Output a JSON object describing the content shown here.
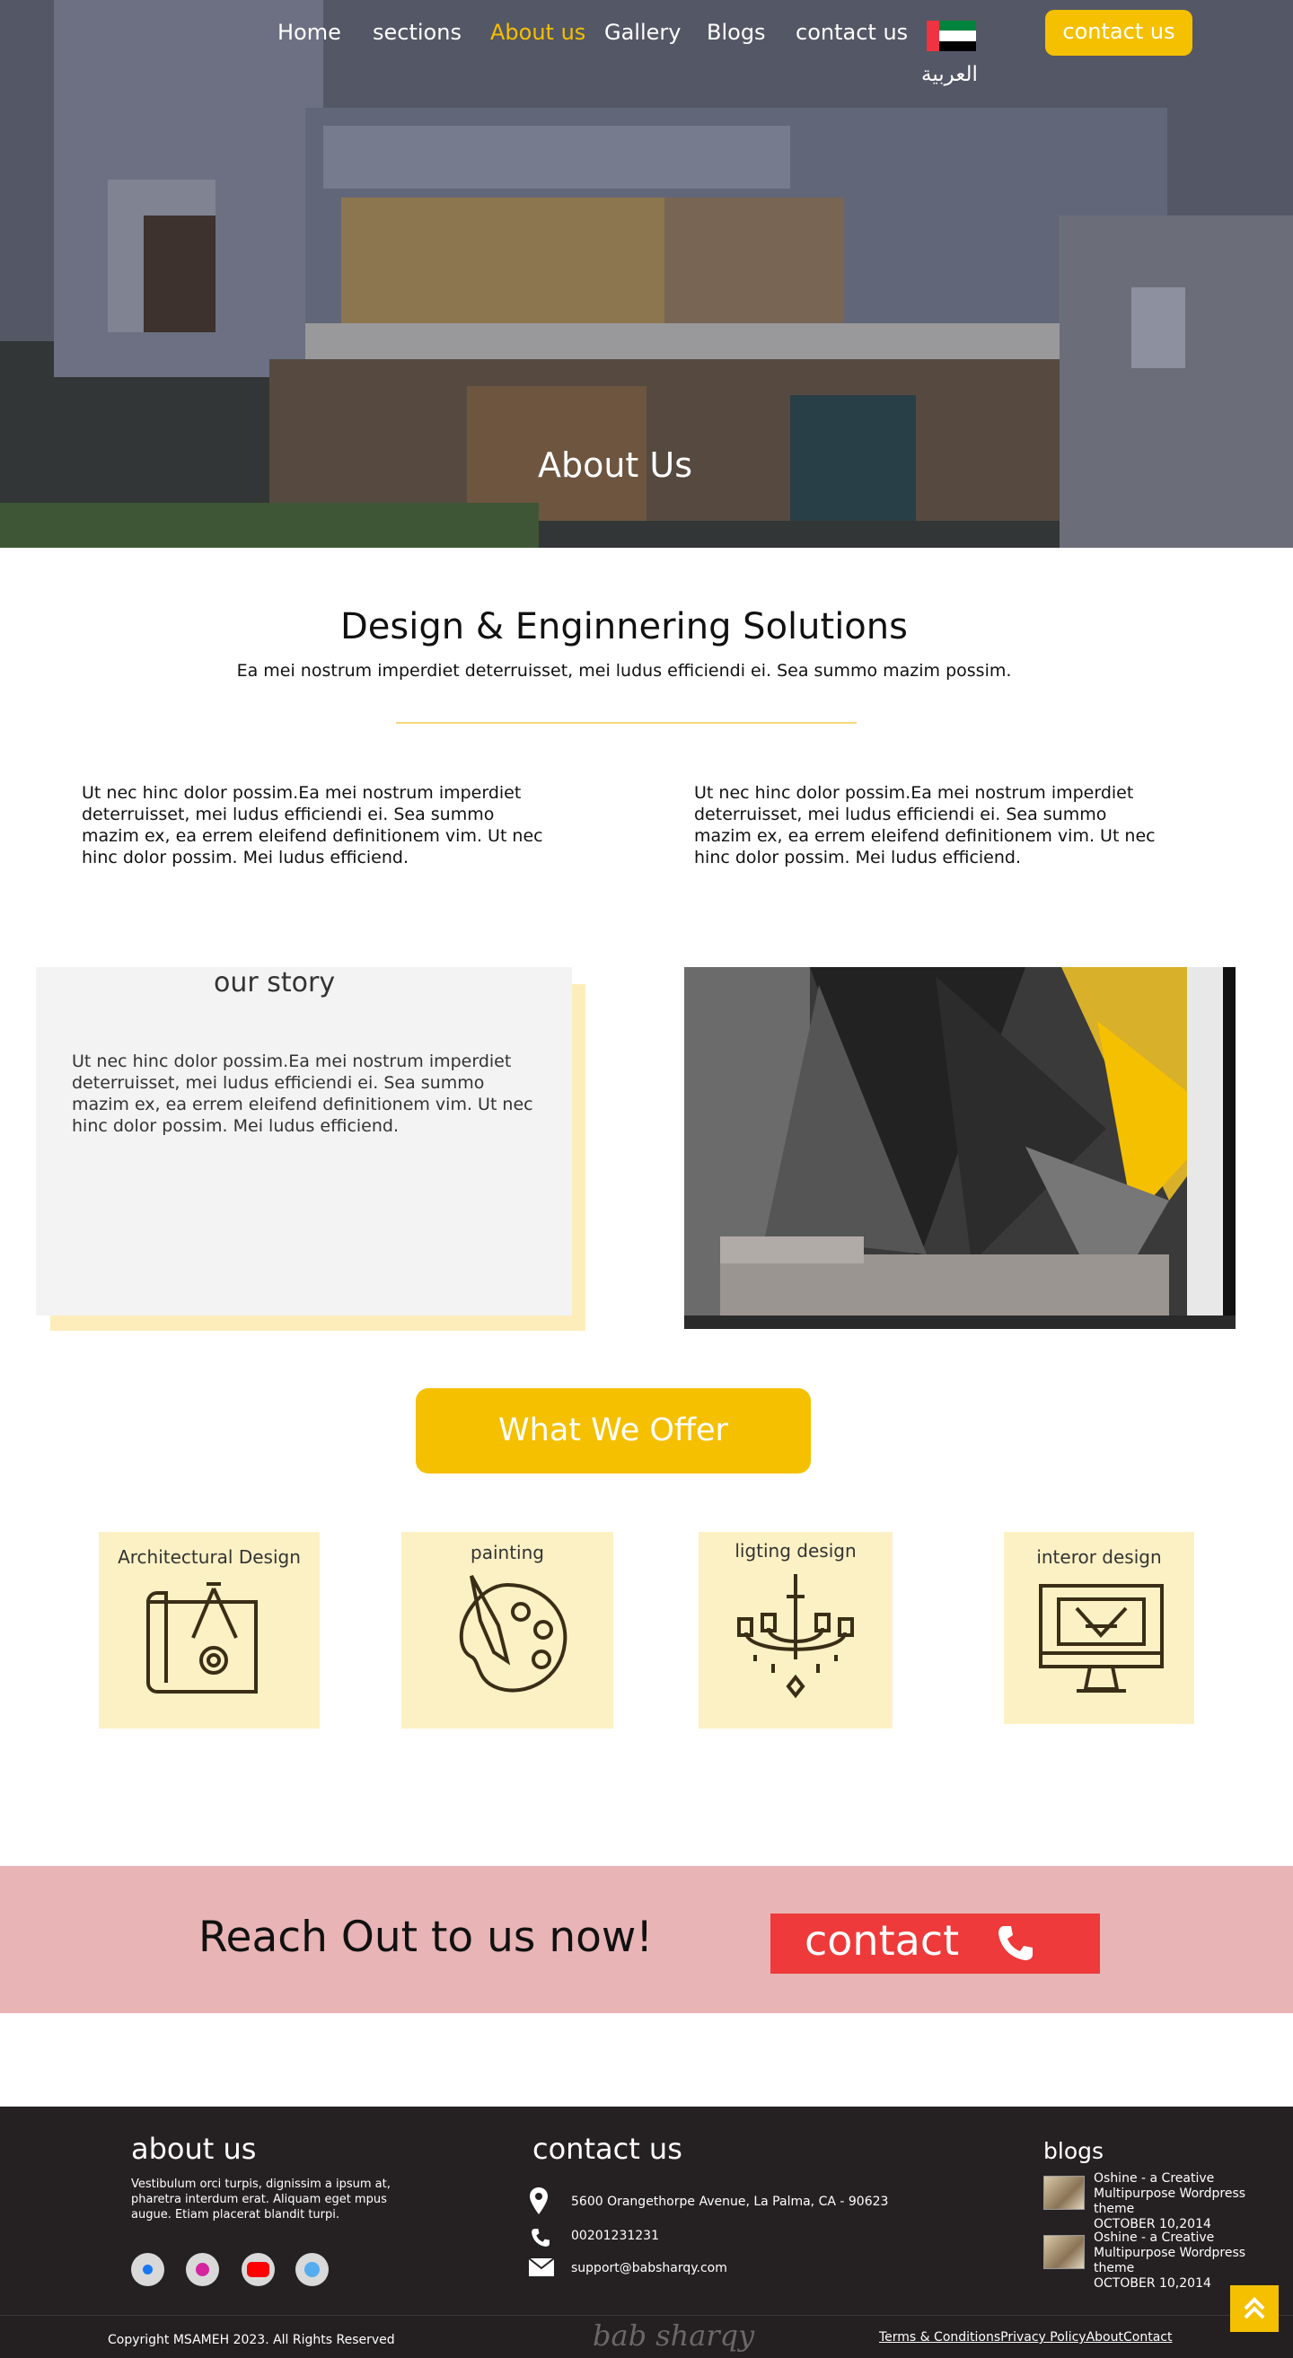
{
  "nav": {
    "items": [
      "Home",
      "sections",
      "About us",
      "Gallery",
      "Blogs",
      "contact us"
    ],
    "active": "About us",
    "language_label": "العربية",
    "contact_button": "contact us"
  },
  "hero": {
    "title": "About Us"
  },
  "intro": {
    "title": "Design & Enginnering Solutions",
    "subtitle": "Ea mei nostrum imperdiet deterruisset, mei ludus efficiendi ei. Sea summo mazim possim.",
    "columns": [
      "Ut nec hinc dolor possim.Ea mei nostrum imperdiet deterruisset, mei ludus efficiendi ei. Sea summo mazim ex, ea errem eleifend definitionem vim. Ut nec hinc dolor possim. Mei ludus efficiend.",
      "Ut nec hinc dolor possim.Ea mei nostrum imperdiet deterruisset, mei ludus efficiendi ei. Sea summo mazim ex, ea errem eleifend definitionem vim. Ut nec hinc dolor possim. Mei ludus efficiend."
    ]
  },
  "story": {
    "title": "our story",
    "text": "Ut nec hinc dolor possim.Ea mei nostrum imperdiet deterruisset, mei ludus efficiendi ei. Sea summo mazim ex, ea errem eleifend definitionem vim. Ut nec hinc dolor possim. Mei ludus efficiend."
  },
  "offer": {
    "button": "What We Offer",
    "services": [
      {
        "label": "Architectural Design",
        "icon": "blueprint-icon"
      },
      {
        "label": "painting",
        "icon": "palette-icon"
      },
      {
        "label": "ligting design",
        "icon": "chandelier-icon"
      },
      {
        "label": "interor design",
        "icon": "monitor-design-icon"
      }
    ]
  },
  "reach": {
    "title": "Reach Out to us now!",
    "button": "contact"
  },
  "footer": {
    "about_title": "about us",
    "about_text": "Vestibulum orci turpis, dignissim a ipsum at, pharetra interdum erat. Aliquam eget mpus augue. Etiam placerat blandit turpi.",
    "social": [
      "facebook-icon",
      "instagram-icon",
      "youtube-icon",
      "twitter-icon"
    ],
    "contact_title": "contact us",
    "address": "5600 Orangethorpe Avenue, La Palma, CA - 90623",
    "phone": "00201231231",
    "email": "support@babsharqy.com",
    "blogs_title": "blogs",
    "blogs": [
      {
        "title": "Oshine - a Creative Multipurpose Wordpress theme",
        "date": "OCTOBER 10,2014"
      },
      {
        "title": "Oshine - a Creative Multipurpose Wordpress theme",
        "date": "OCTOBER 10,2014"
      }
    ],
    "copyright": "Copyright MSAMEH 2023. All Rights Reserved",
    "signature": "bab sharqy",
    "links": [
      "Terms & Conditions",
      "Privacy Policy",
      "About",
      "Contact"
    ]
  },
  "colors": {
    "accent": "#f5c000",
    "reach_bg": "#e8b4b6",
    "contact_red": "#ee3a3a",
    "footer_bg": "#252122",
    "card_bg": "#fcf1c4"
  }
}
